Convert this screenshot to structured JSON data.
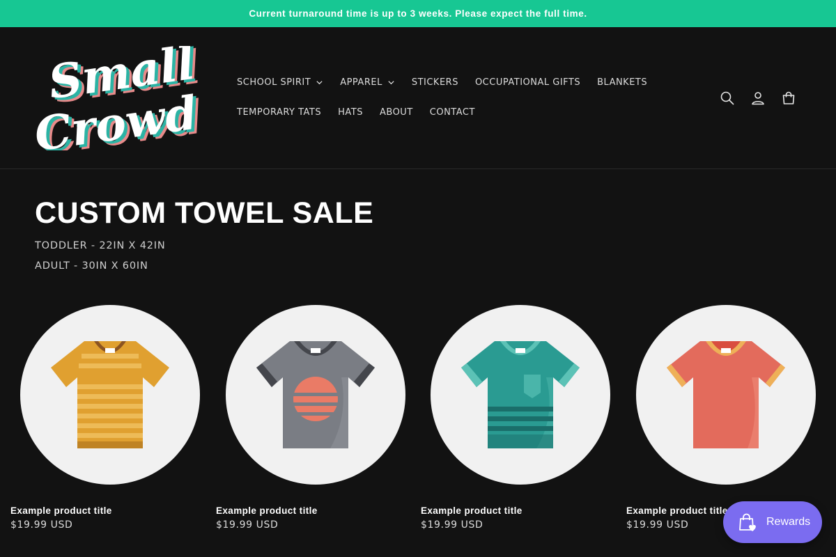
{
  "announcement": {
    "text": "Current turnaround time is up to 3 weeks. Please expect the full time."
  },
  "logo": {
    "line1": "Small",
    "line2": "Crowd"
  },
  "nav": {
    "row1": [
      {
        "label": "SCHOOL SPIRIT",
        "has_dropdown": true
      },
      {
        "label": "APPAREL",
        "has_dropdown": true
      },
      {
        "label": "STICKERS",
        "has_dropdown": false
      },
      {
        "label": "OCCUPATIONAL GIFTS",
        "has_dropdown": false
      },
      {
        "label": "BLANKETS",
        "has_dropdown": false
      }
    ],
    "row2": [
      {
        "label": "TEMPORARY TATS",
        "has_dropdown": false
      },
      {
        "label": "HATS",
        "has_dropdown": false
      },
      {
        "label": "ABOUT",
        "has_dropdown": false
      },
      {
        "label": "CONTACT",
        "has_dropdown": false
      }
    ]
  },
  "header_icons": [
    "search-icon",
    "account-icon",
    "cart-icon"
  ],
  "hero": {
    "title": "CUSTOM TOWEL SALE",
    "line1": "TODDLER - 22IN X 42IN",
    "line2": "ADULT - 30IN X 60IN"
  },
  "products": [
    {
      "title": "Example product title",
      "price": "$19.99 USD",
      "shirt_color": "#e0a030",
      "shirt_style": "striped"
    },
    {
      "title": "Example product title",
      "price": "$19.99 USD",
      "shirt_color": "#7a7d84",
      "shirt_style": "sun"
    },
    {
      "title": "Example product title",
      "price": "$19.99 USD",
      "shirt_color": "#2a9b92",
      "shirt_style": "pocket"
    },
    {
      "title": "Example product title",
      "price": "$19.99 USD",
      "shirt_color": "#e36b5c",
      "shirt_style": "plain"
    }
  ],
  "rewards": {
    "label": "Rewards"
  },
  "colors": {
    "announcement_bg": "#17c793",
    "page_bg": "#121212",
    "card_bg": "#f1f1f1",
    "rewards_bg": "#7b6cf0"
  }
}
